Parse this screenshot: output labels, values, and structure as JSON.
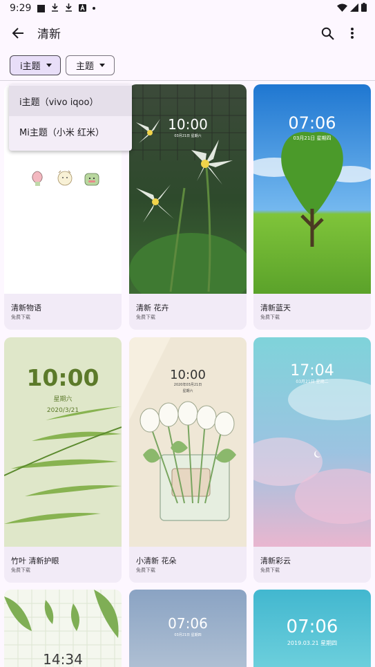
{
  "status_bar": {
    "time": "9:29"
  },
  "app_bar": {
    "title": "清新"
  },
  "filters": [
    {
      "label": "i主题",
      "selected": true
    },
    {
      "label": "主题",
      "selected": false
    }
  ],
  "dropdown": {
    "items": [
      {
        "label": "i主题（vivo iqoo）",
        "active": true
      },
      {
        "label": "Mi主题（小米 红米）",
        "active": false
      }
    ]
  },
  "cards": [
    {
      "title": "清新物语",
      "sub": "免费下载"
    },
    {
      "title": "清新 花卉",
      "sub": "免费下载",
      "clock": "10:00",
      "date": "03月21日 星期六"
    },
    {
      "title": "清新蓝天",
      "sub": "免费下载",
      "clock": "07:06",
      "date": "03月21日 星期四"
    },
    {
      "title": "竹叶 清新护眼",
      "sub": "免费下载",
      "clock": "10:00",
      "date": "星期六",
      "date2": "2020/3/21"
    },
    {
      "title": "小清新 花朵",
      "sub": "免费下载",
      "clock": "10:00",
      "date": "2020年03月21日",
      "date2": "星期六"
    },
    {
      "title": "清新彩云",
      "sub": "免费下载",
      "clock": "17:04",
      "date": "03月21日 星期二"
    },
    {
      "clock": "14:34"
    },
    {
      "clock": "07:06",
      "date": "03月21日 星期四"
    },
    {
      "clock": "07:06",
      "date": "2019.03.21 星期四"
    }
  ],
  "colors": {
    "accent": "#6750a4",
    "chip_selected": "#e8def8",
    "card_bg": "#f2ebf7",
    "background": "#fdf7ff"
  }
}
